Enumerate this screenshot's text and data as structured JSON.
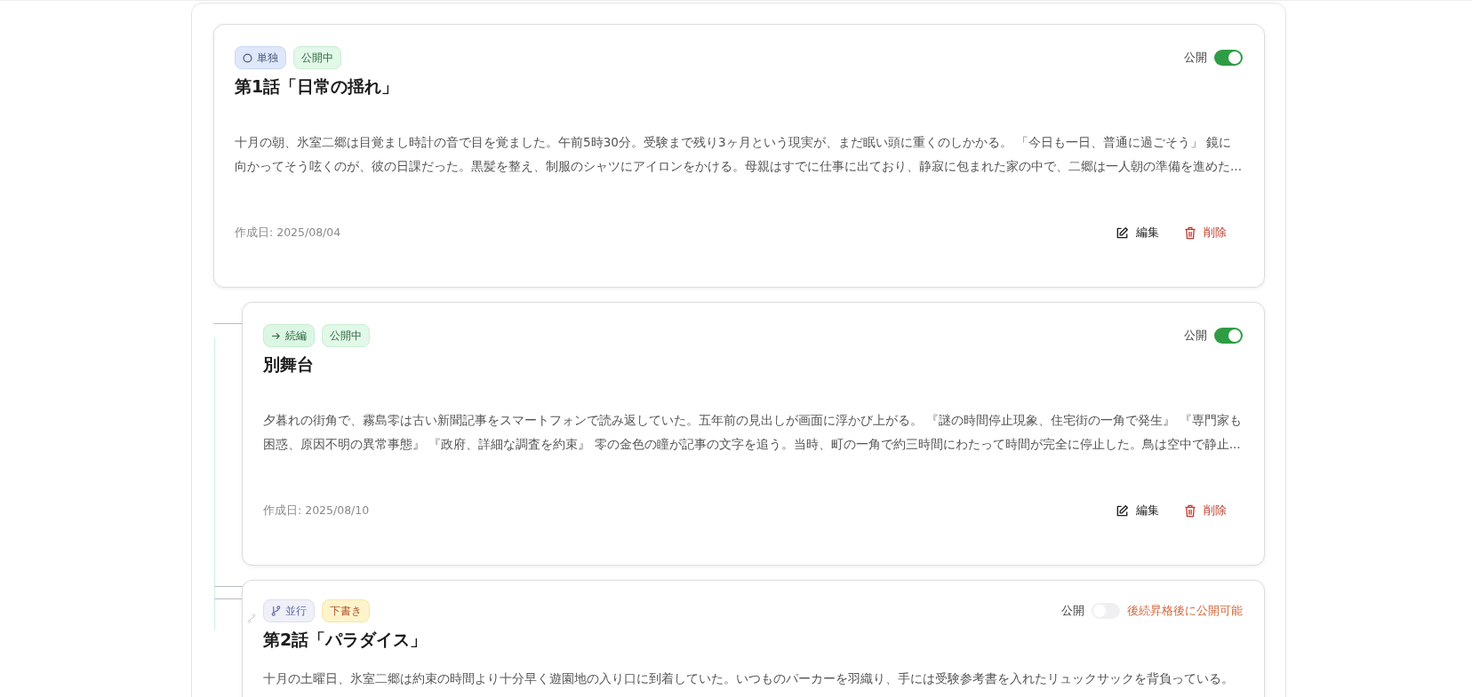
{
  "episodes": [
    {
      "relation": {
        "kind": "single",
        "label": "単独"
      },
      "status": {
        "kind": "published",
        "label": "公開中"
      },
      "title": "第1話「日常の揺れ」",
      "public_label": "公開",
      "public": true,
      "description": "十月の朝、氷室二郷は目覚まし時計の音で目を覚ました。午前5時30分。受験まで残り3ヶ月という現実が、まだ眠い頭に重くのしかかる。 「今日も一日、普通に過ごそう」 鏡に向かってそう呟くのが、彼の日課だった。黒髪を整え、制服のシャツにアイロンをかける。母親はすでに仕事に出ており、静寂に包まれた家の中で、二郷は一人朝の準備を進めた...",
      "created": "作成日: 2025/08/04",
      "actions": [
        {
          "kind": "edit",
          "label": "編集"
        },
        {
          "kind": "delete",
          "label": "削除"
        }
      ],
      "children": [
        {
          "relation": {
            "kind": "sequel",
            "label": "続編"
          },
          "status": {
            "kind": "published",
            "label": "公開中"
          },
          "title": "別舞台",
          "public_label": "公開",
          "public": true,
          "description": "夕暮れの街角で、霧島零は古い新聞記事をスマートフォンで読み返していた。五年前の見出しが画面に浮かび上がる。 『謎の時間停止現象、住宅街の一角で発生』 『専門家も困惑、原因不明の異常事態』 『政府、詳細な調査を約束』 零の金色の瞳が記事の文字を追う。当時、町の一角で約三時間にわたって時間が完全に停止した。鳥は空中で静止...",
          "created": "作成日: 2025/08/10",
          "actions": [
            {
              "kind": "edit",
              "label": "編集"
            },
            {
              "kind": "delete",
              "label": "削除"
            }
          ]
        },
        {
          "relation": {
            "kind": "parallel",
            "label": "並行"
          },
          "status": {
            "kind": "draft",
            "label": "下書き"
          },
          "title": "第2話「パラダイス」",
          "public_label": "公開",
          "public": false,
          "note": "後続昇格後に公開可能",
          "description": "十月の土曜日、氷室二郷は約束の時間より十分早く遊園地の入り口に到着していた。いつものパーカーを羽織り、手には受験参考書を入れたリュックサックを背負っている。"
        }
      ]
    }
  ]
}
